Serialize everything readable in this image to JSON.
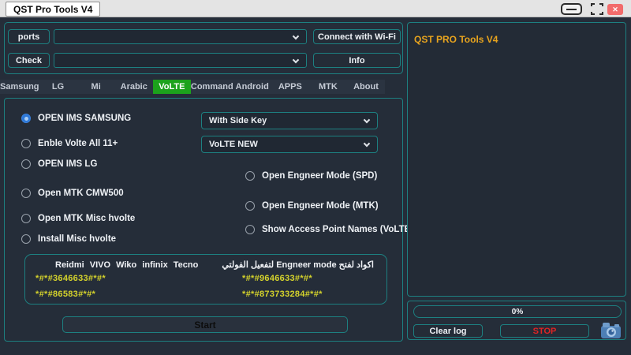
{
  "window": {
    "title": "QST Pro Tools V4",
    "close_glyph": "✕"
  },
  "top_panel": {
    "ports_button": "ports",
    "check_button": "Check",
    "connect_wifi_button": "Connect with Wi-Fi",
    "info_button": "Info",
    "ports_select_value": "",
    "check_select_value": ""
  },
  "tabs": [
    {
      "label": "Samsung",
      "active": false
    },
    {
      "label": "LG",
      "active": false
    },
    {
      "label": "Mi",
      "active": false
    },
    {
      "label": "Arabic",
      "active": false
    },
    {
      "label": "VoLTE",
      "active": true
    },
    {
      "label": "Command",
      "active": false
    },
    {
      "label": "Android",
      "active": false
    },
    {
      "label": "APPS",
      "active": false
    },
    {
      "label": "MTK",
      "active": false
    },
    {
      "label": "About",
      "active": false
    }
  ],
  "volte_tab": {
    "left_options": [
      {
        "label": "OPEN IMS SAMSUNG",
        "selected": true
      },
      {
        "label": "Enble Volte All 11+",
        "selected": false
      },
      {
        "label": "OPEN IMS LG",
        "selected": false
      },
      {
        "label": "Open MTK CMW500",
        "selected": false
      },
      {
        "label": "Open MTK Misc hvolte",
        "selected": false
      },
      {
        "label": "Install  Misc hvolte",
        "selected": false
      }
    ],
    "right_options": [
      {
        "label": "Open Engneer Mode (SPD)",
        "selected": false
      },
      {
        "label": "Open Engneer Mode (MTK)",
        "selected": false
      },
      {
        "label": "Show Access Point Names (VoLTE)",
        "selected": false
      }
    ],
    "dropdowns": [
      {
        "value": "With Side Key"
      },
      {
        "value": "VoLTE NEW"
      }
    ],
    "codes_box": {
      "brands_header": "Reidmi  VIVO  Wiko  infinix  Tecno",
      "arabic_header": "اكواد لفتح Engneer mode لتفعيل الفولتي",
      "left_codes": [
        "*#*#3646633#*#*",
        "*#*#86583#*#*"
      ],
      "right_codes": [
        "*#*#9646633#*#*",
        "*#*#873733284#*#*"
      ]
    },
    "start_button": "Start"
  },
  "log_panel": {
    "header": "QST PRO Tools V4"
  },
  "bottom_panel": {
    "progress": "0%",
    "clear_log_button": "Clear log",
    "stop_button": "STOP"
  },
  "colors": {
    "accent_teal": "#1d8081",
    "active_tab_green": "#1ca21c",
    "log_header_orange": "#e8a41e",
    "code_yellow": "#d5d32c",
    "stop_red": "#e02424",
    "radio_selected_blue": "#2d78d8",
    "close_red": "#f26c6c",
    "background": "#252d39"
  }
}
